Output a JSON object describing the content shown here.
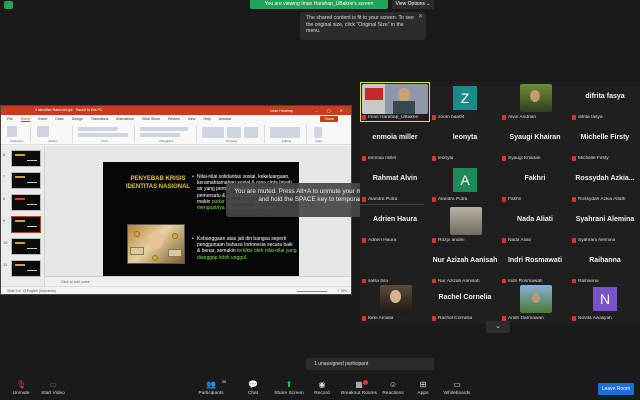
{
  "top": {
    "viewing_banner": "You are viewing Iman Harahap_UBakrie's screen",
    "view_options": "View Options ⌄"
  },
  "tooltip": {
    "text": "The shared content is fit to your screen. To see the original size, click \"Original Size\" in the menu."
  },
  "ppt": {
    "title": "4 Identitas Nasional.ppt · Saved to this PC",
    "signin": "Iman Harahap",
    "tabs": [
      "File",
      "Home",
      "Insert",
      "Draw",
      "Design",
      "Transitions",
      "Animations",
      "Slide Show",
      "Review",
      "View",
      "Help",
      "Acrobat"
    ],
    "share_label": "Share",
    "ribbon_groups": [
      "Clipboard",
      "Slides",
      "Font",
      "Paragraph",
      "Drawing",
      "Editing",
      "Voice"
    ],
    "thumb_numbers": [
      "6",
      "7",
      "8",
      "9",
      "10",
      "11"
    ],
    "slide_title": "PENYEBAB KRISIS IDENTITAS NASIONAL",
    "bullet1_a": "Nilai-nilai solidaritas sosial, kekeluargaan, keramahtamahan sosial & rasa cinta tanah air yang pernah dianggap sebagai kekuatan pemersatu & ciri khas bangsa Indonesia, makin ",
    "bullet1_hl": "pudar bersamaan dengan makin menguatnya nilai-nilai materialisme.",
    "bullet2_a": "Kebanggaan atas jati diri bangsa seperti penggunaan bahasa Indonesia secara baik & benar, semakin ",
    "bullet2_hl": "terkikis oleh nilai-nilai yang dianggap lebih unggul.",
    "notes_placeholder": "Click to add notes",
    "status_left": "Slide 9 of 13    English (Indonesia)",
    "status_zoom": "+ 78%"
  },
  "muted_toast": "You are muted. Press Alt+A to unmute your microphone, or press and hold the SPACE key to temporarily unmute.",
  "participants": [
    {
      "name": "Iman Harahap_UBakrie",
      "kind": "video"
    },
    {
      "name": "zoom baa04",
      "kind": "letter",
      "letter": "Z",
      "color": "#1d8a8a"
    },
    {
      "name": "Alvin Andrian",
      "kind": "photo"
    },
    {
      "name": "difrita fasya",
      "kind": "text",
      "big": "difrita fasya"
    },
    {
      "name": "enmoia miller",
      "kind": "text",
      "big": "enmoia miller"
    },
    {
      "name": "leonyta",
      "kind": "text",
      "big": "leonyta"
    },
    {
      "name": "Syaugi Khairan",
      "kind": "text",
      "big": "Syaugi Khairan"
    },
    {
      "name": "Michelle Firsty",
      "kind": "text",
      "big": "Michelle Firsty"
    },
    {
      "name": "Alandra Putra",
      "kind": "text",
      "big": "Rahmat Alvin"
    },
    {
      "name": "Fakhri",
      "kind": "letter",
      "letter": "A",
      "color": "#1d8a5a"
    },
    {
      "name": "Rossydah Azkia Alfath",
      "kind": "text",
      "big": "Fakhri"
    },
    {
      "name": "Rossydah Azkia Alfath",
      "kind": "text",
      "big": "Rossydah Azkia..."
    },
    {
      "name": "Adrien Haura",
      "kind": "text",
      "big": "Adrien Haura"
    },
    {
      "name": "Rozpi andini",
      "kind": "photo"
    },
    {
      "name": "Nada Aliati",
      "kind": "text",
      "big": "Nada Aliati"
    },
    {
      "name": "Syahrani Alemina",
      "kind": "text",
      "big": "Syahrani Alemina"
    },
    {
      "name": "salsa bila",
      "kind": "text",
      "big": ""
    },
    {
      "name": "Nur Azizah Aanisah",
      "kind": "text",
      "big": "Nur Azizah Aanisah"
    },
    {
      "name": "Indri Rosmawati",
      "kind": "text",
      "big": "Indri Rosmawati"
    },
    {
      "name": "Raihanna",
      "kind": "text",
      "big": "Raihanna"
    },
    {
      "name": "Kirei Amalia",
      "kind": "photo"
    },
    {
      "name": "Rachel Cornelia",
      "kind": "text",
      "big": "Rachel Cornelia"
    },
    {
      "name": "Andri Darmawan",
      "kind": "photo"
    },
    {
      "name": "Novita Awaliyah",
      "kind": "letter",
      "letter": "N",
      "color": "#7a52c7"
    }
  ],
  "unassigned": "1 unassigned participant",
  "toolbar": {
    "unmute": "Unmute",
    "start_video": "Start Video",
    "participants": "Participants",
    "participants_count": "58",
    "chat": "Chat",
    "share_screen": "Share Screen",
    "record": "Record",
    "breakout": "Breakout Rooms",
    "reactions": "Reactions",
    "apps": "Apps",
    "whiteboards": "Whiteboards",
    "leave": "Leave Room"
  },
  "colors": {
    "zoom_green": "#23a35a",
    "ppt_red": "#c43e1c",
    "leave_blue": "#1a6fd8",
    "slide_title_gold": "#e7c43a"
  }
}
